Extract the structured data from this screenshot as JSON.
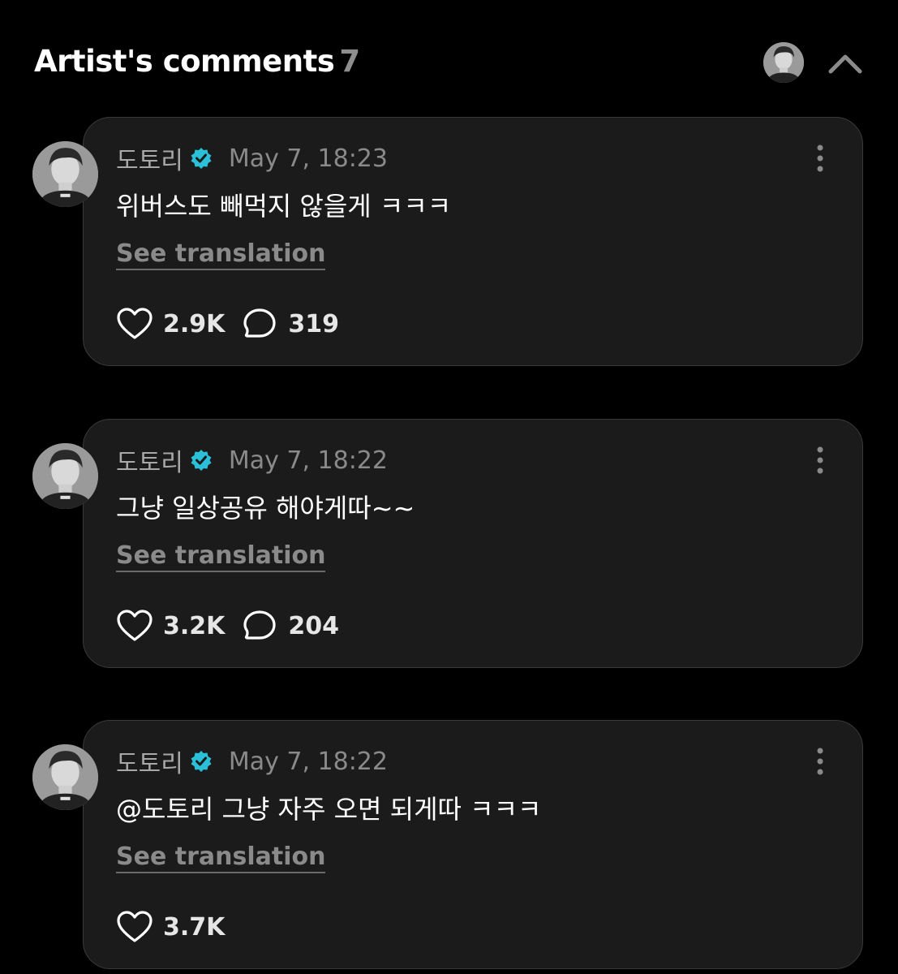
{
  "header": {
    "title": "Artist's comments",
    "count": "7"
  },
  "comments": [
    {
      "author": "도토리",
      "timestamp": "May 7, 18:23",
      "text": "위버스도 빼먹지 않을게 ㅋㅋㅋ",
      "translate_label": "See translation",
      "likes": "2.9K",
      "replies": "319"
    },
    {
      "author": "도토리",
      "timestamp": "May 7, 18:22",
      "text": "그냥 일상공유 해야게따~~",
      "translate_label": "See translation",
      "likes": "3.2K",
      "replies": "204"
    },
    {
      "author": "도토리",
      "timestamp": "May 7, 18:22",
      "text": "@도토리 그냥 자주 오면 되게따 ㅋㅋㅋ",
      "translate_label": "See translation",
      "likes": "3.7K"
    }
  ],
  "icons": {
    "header_avatar": "avatar",
    "collapse": "chevron-up-icon",
    "verified": "verified-badge-icon",
    "more": "more-vertical-icon",
    "like": "heart-icon",
    "reply": "comment-bubble-icon"
  },
  "colors": {
    "background": "#000000",
    "card": "#1b1b1b",
    "card_border": "#3a3a3a",
    "verified": "#2bc0d8",
    "muted": "#8a8a8a"
  }
}
